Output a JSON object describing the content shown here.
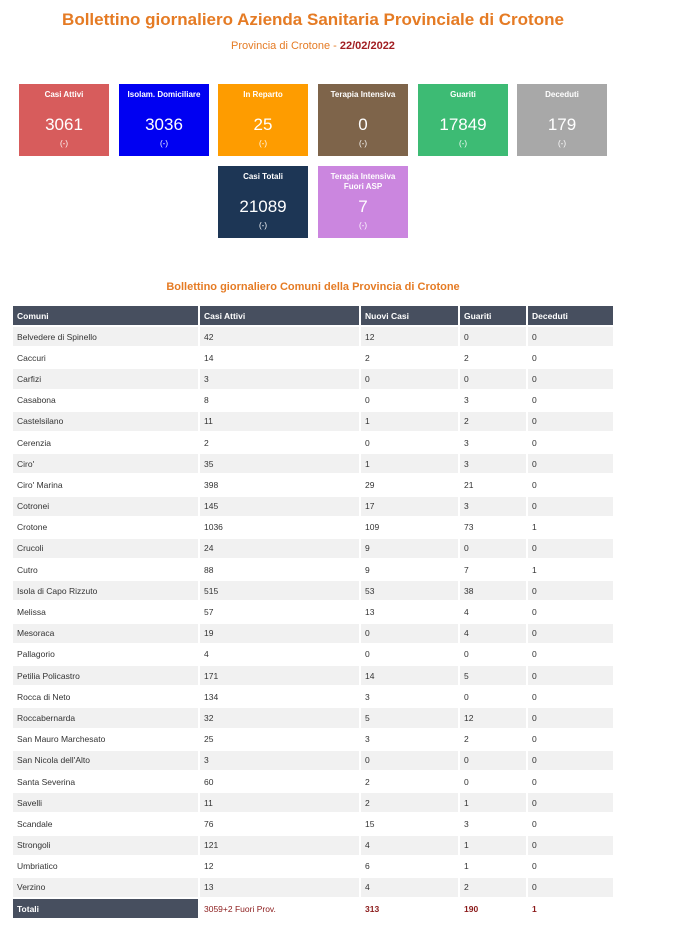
{
  "header": {
    "title": "Bollettino giornaliero Azienda Sanitaria Provinciale di Crotone",
    "subtitle_prefix": "Provincia di Crotone - ",
    "date": "22/02/2022"
  },
  "colors": {
    "accent": "#e57b24",
    "date": "#a11d21",
    "table_header": "#474f5f"
  },
  "cards": [
    {
      "label": "Casi Attivi",
      "value": "3061",
      "change": "(-)",
      "color": "#d75c5c"
    },
    {
      "label": "Isolam. Domiciliare",
      "value": "3036",
      "change": "(-)",
      "color": "#0000f2"
    },
    {
      "label": "In Reparto",
      "value": "25",
      "change": "(-)",
      "color": "#fe9c00"
    },
    {
      "label": "Terapia Intensiva",
      "value": "0",
      "change": "(-)",
      "color": "#7e644a"
    },
    {
      "label": "Guariti",
      "value": "17849",
      "change": "(-)",
      "color": "#3dbb74"
    },
    {
      "label": "Deceduti",
      "value": "179",
      "change": "(-)",
      "color": "#a8a8a8"
    },
    {
      "label": "Casi Totali",
      "value": "21089",
      "change": "(-)",
      "color": "#1d3655"
    },
    {
      "label": "Terapia Intensiva Fuori ASP",
      "value": "7",
      "change": "(-)",
      "color": "#cb86df"
    }
  ],
  "comuni_section": {
    "title": "Bollettino giornaliero Comuni della Provincia di Crotone",
    "headers": [
      "Comuni",
      "Casi Attivi",
      "Nuovi Casi",
      "Guariti",
      "Deceduti"
    ],
    "rows": [
      [
        "Belvedere di Spinello",
        "42",
        "12",
        "0",
        "0"
      ],
      [
        "Caccuri",
        "14",
        "2",
        "2",
        "0"
      ],
      [
        "Carfizi",
        "3",
        "0",
        "0",
        "0"
      ],
      [
        "Casabona",
        "8",
        "0",
        "3",
        "0"
      ],
      [
        "Castelsilano",
        "11",
        "1",
        "2",
        "0"
      ],
      [
        "Cerenzia",
        "2",
        "0",
        "3",
        "0"
      ],
      [
        "Ciro'",
        "35",
        "1",
        "3",
        "0"
      ],
      [
        "Ciro' Marina",
        "398",
        "29",
        "21",
        "0"
      ],
      [
        "Cotronei",
        "145",
        "17",
        "3",
        "0"
      ],
      [
        "Crotone",
        "1036",
        "109",
        "73",
        "1"
      ],
      [
        "Crucoli",
        "24",
        "9",
        "0",
        "0"
      ],
      [
        "Cutro",
        "88",
        "9",
        "7",
        "1"
      ],
      [
        "Isola di Capo Rizzuto",
        "515",
        "53",
        "38",
        "0"
      ],
      [
        "Melissa",
        "57",
        "13",
        "4",
        "0"
      ],
      [
        "Mesoraca",
        "19",
        "0",
        "4",
        "0"
      ],
      [
        "Pallagorio",
        "4",
        "0",
        "0",
        "0"
      ],
      [
        "Petilia Policastro",
        "171",
        "14",
        "5",
        "0"
      ],
      [
        "Rocca di Neto",
        "134",
        "3",
        "0",
        "0"
      ],
      [
        "Roccabernarda",
        "32",
        "5",
        "12",
        "0"
      ],
      [
        "San Mauro Marchesato",
        "25",
        "3",
        "2",
        "0"
      ],
      [
        "San Nicola dell'Alto",
        "3",
        "0",
        "0",
        "0"
      ],
      [
        "Santa Severina",
        "60",
        "2",
        "0",
        "0"
      ],
      [
        "Savelli",
        "11",
        "2",
        "1",
        "0"
      ],
      [
        "Scandale",
        "76",
        "15",
        "3",
        "0"
      ],
      [
        "Strongoli",
        "121",
        "4",
        "1",
        "0"
      ],
      [
        "Umbriatico",
        "12",
        "6",
        "1",
        "0"
      ],
      [
        "Verzino",
        "13",
        "4",
        "2",
        "0"
      ]
    ],
    "totals": [
      "Totali",
      "3059+2 Fuori Prov.",
      "313",
      "190",
      "1"
    ]
  }
}
